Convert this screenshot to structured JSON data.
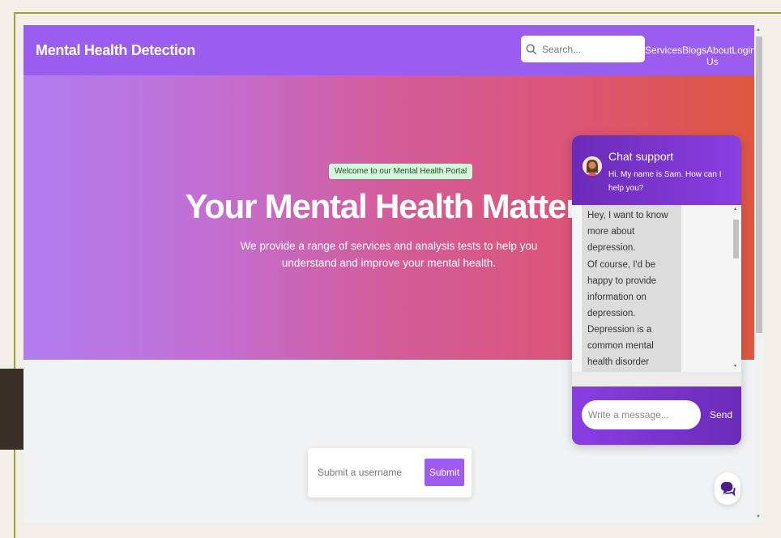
{
  "navbar": {
    "brand": "Mental Health Detection",
    "search_placeholder": "Search...",
    "links": [
      "Services",
      "Blogs",
      "About Us",
      "Login"
    ]
  },
  "hero": {
    "badge": "Welcome to our Mental Health Portal",
    "title": "Your Mental Health Matters",
    "subtitle": "We provide a range of services and analysis tests to help you understand and improve your mental health."
  },
  "username_form": {
    "placeholder": "Submit a username",
    "submit_label": "Submit"
  },
  "chat": {
    "title": "Chat support",
    "greeting": "Hi. My name is Sam. How can I help you?",
    "messages": [
      "Hey, I want to know more about depression.",
      "Of course, I'd be happy to provide information on depression. Depression is a common mental health disorder characterized by persistent feelings of"
    ],
    "input_placeholder": "Write a message...",
    "send_label": "Send"
  },
  "colors": {
    "navbar": "#9b5cf0",
    "accent": "#a259f2",
    "chat_header": "#6b2bb8"
  }
}
